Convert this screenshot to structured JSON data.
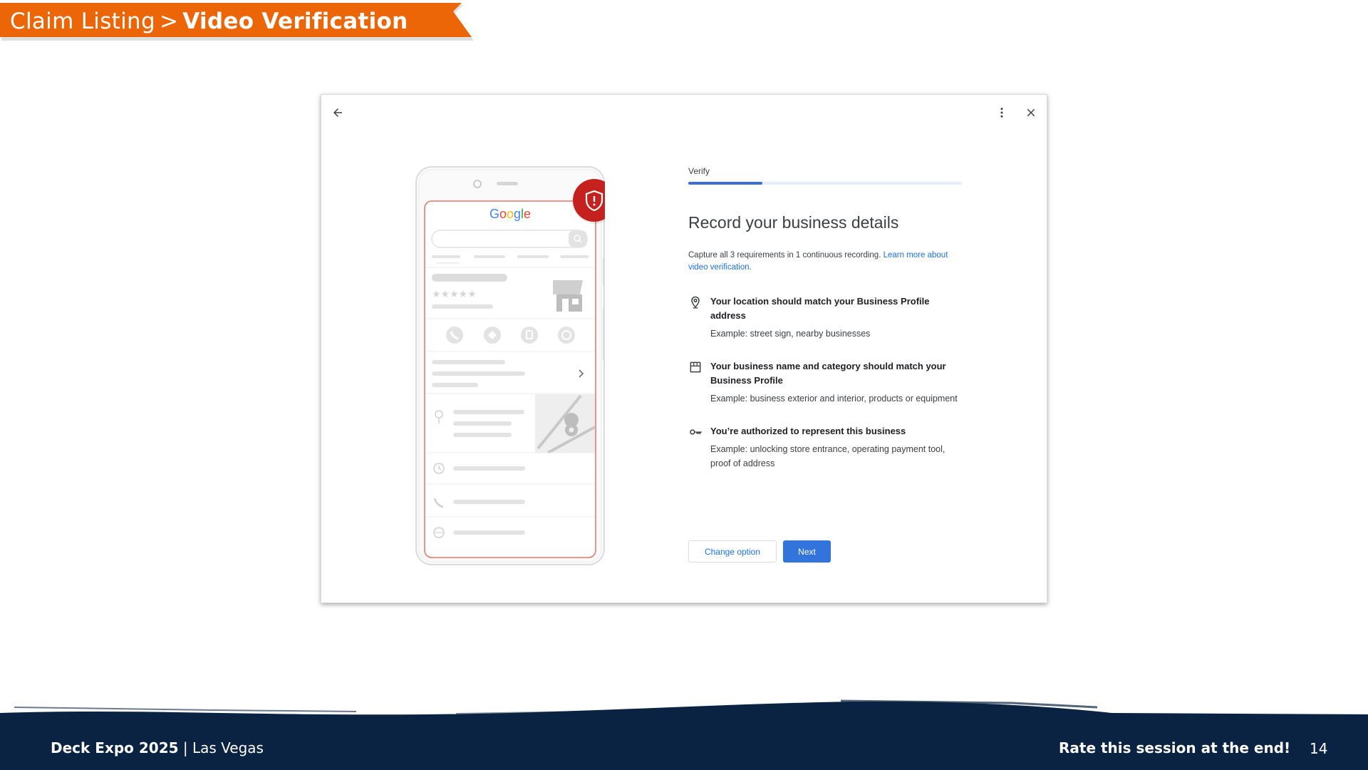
{
  "banner": {
    "crumb": "Claim Listing",
    "separator": ">",
    "current": "Video Verification",
    "color": "#ec6608"
  },
  "dialog": {
    "back_icon": "arrow-left-icon",
    "more_icon": "more-vert-icon",
    "close_icon": "close-icon",
    "phone": {
      "logo_text": "Google",
      "badge_icon": "shield-alert-icon"
    },
    "step_label": "Verify",
    "progress_fraction": 0.27,
    "title": "Record your business details",
    "intro": "Capture all 3 requirements in 1 continuous recording.",
    "intro_link": "Learn more about video verification.",
    "requirements": [
      {
        "icon": "location-pin-icon",
        "title": "Your location should match your Business Profile address",
        "example": "Example: street sign, nearby businesses"
      },
      {
        "icon": "storefront-icon",
        "title": "Your business name and category should match your Business Profile",
        "example": "Example: business exterior and interior, products or equipment"
      },
      {
        "icon": "key-icon",
        "title": "You’re authorized to represent this business",
        "example": "Example: unlocking store entrance, operating payment tool, proof of address"
      }
    ],
    "buttons": {
      "change_option": "Change option",
      "next": "Next"
    },
    "colors": {
      "primary": "#3273dc",
      "link": "#1a73e8",
      "badge": "#c5221f"
    }
  },
  "footer": {
    "event": "Deck Expo 2025",
    "divider": "|",
    "location": "Las Vegas",
    "cta": "Rate this session at the end!",
    "page_number": "14",
    "color": "#0b2342"
  }
}
